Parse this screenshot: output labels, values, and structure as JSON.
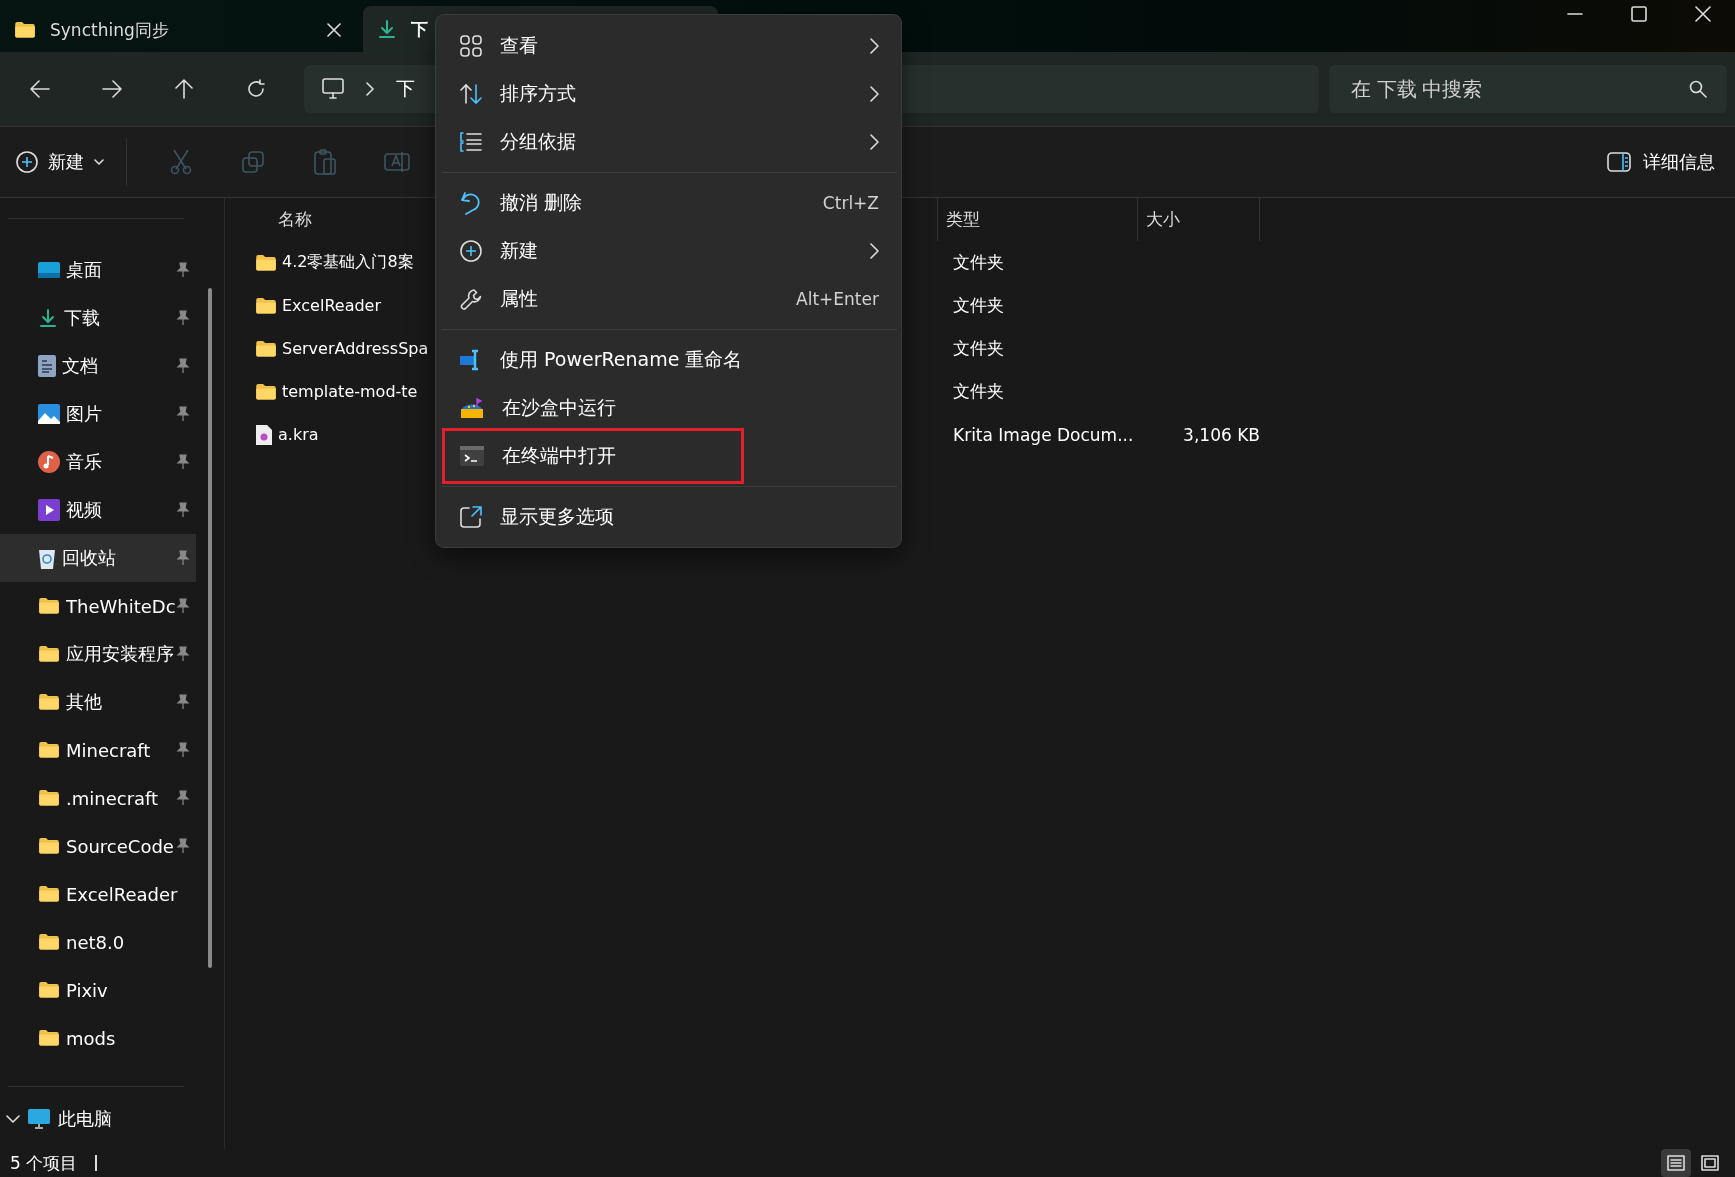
{
  "tabs": [
    {
      "label": "Syncthing同步",
      "kind": "folder",
      "selected": false
    },
    {
      "label": "下",
      "kind": "download",
      "selected": true
    }
  ],
  "address_bar": {
    "crumbs": [
      "下"
    ]
  },
  "search": {
    "placeholder": "在 下载 中搜索"
  },
  "command_bar": {
    "new_label": "新建",
    "details_label": "详细信息"
  },
  "sidebar": {
    "items": [
      {
        "label": "桌面",
        "kind": "desktop",
        "pinned": true,
        "selected": false
      },
      {
        "label": "下载",
        "kind": "download",
        "pinned": true,
        "selected": false
      },
      {
        "label": "文档",
        "kind": "document",
        "pinned": true,
        "selected": false
      },
      {
        "label": "图片",
        "kind": "picture",
        "pinned": true,
        "selected": false
      },
      {
        "label": "音乐",
        "kind": "music",
        "pinned": true,
        "selected": false
      },
      {
        "label": "视频",
        "kind": "video",
        "pinned": true,
        "selected": false
      },
      {
        "label": "回收站",
        "kind": "recycle",
        "pinned": true,
        "selected": true
      },
      {
        "label": "TheWhiteDc",
        "kind": "folder",
        "pinned": true,
        "selected": false
      },
      {
        "label": "应用安装程序",
        "kind": "folder",
        "pinned": true,
        "selected": false
      },
      {
        "label": "其他",
        "kind": "folder",
        "pinned": true,
        "selected": false
      },
      {
        "label": "Minecraft",
        "kind": "folder",
        "pinned": true,
        "selected": false
      },
      {
        "label": ".minecraft",
        "kind": "folder",
        "pinned": true,
        "selected": false
      },
      {
        "label": "SourceCode",
        "kind": "folder",
        "pinned": true,
        "selected": false
      },
      {
        "label": "ExcelReader",
        "kind": "folder",
        "pinned": false,
        "selected": false
      },
      {
        "label": "net8.0",
        "kind": "folder",
        "pinned": false,
        "selected": false
      },
      {
        "label": "Pixiv",
        "kind": "folder",
        "pinned": false,
        "selected": false
      },
      {
        "label": "mods",
        "kind": "folder",
        "pinned": false,
        "selected": false
      }
    ],
    "this_pc": {
      "label": "此电脑",
      "expanded": true
    }
  },
  "table": {
    "columns": [
      "名称",
      "类型",
      "大小"
    ],
    "rows": [
      {
        "name": "4.2零基础入门8案",
        "kind": "folder",
        "type": "文件夹"
      },
      {
        "name": "ExcelReader",
        "kind": "folder",
        "type": "文件夹"
      },
      {
        "name": "ServerAddressSpa",
        "kind": "folder",
        "type": "文件夹"
      },
      {
        "name": "template-mod-te",
        "kind": "folder",
        "type": "文件夹"
      },
      {
        "name": "a.kra",
        "kind": "file",
        "type": "Krita Image Docum...",
        "size": "3,106 KB"
      }
    ]
  },
  "context_menu": {
    "sections": [
      [
        {
          "label": "查看",
          "kind": "grid",
          "submenu": true,
          "highlighted": false
        },
        {
          "label": "排序方式",
          "kind": "sort",
          "submenu": true,
          "highlighted": false
        },
        {
          "label": "分组依据",
          "kind": "group",
          "submenu": true,
          "highlighted": false
        }
      ],
      [
        {
          "label": "撤消 删除",
          "kind": "undo",
          "shortcut": "Ctrl+Z",
          "submenu": false,
          "highlighted": false
        },
        {
          "label": "新建",
          "kind": "plus",
          "submenu": true,
          "highlighted": false
        },
        {
          "label": "属性",
          "kind": "wrench",
          "shortcut": "Alt+Enter",
          "submenu": false,
          "highlighted": false
        }
      ],
      [
        {
          "label": "使用 PowerRename 重命名",
          "kind": "rename",
          "submenu": false,
          "highlighted": false
        },
        {
          "label": "在沙盒中运行",
          "kind": "sandbox",
          "submenu": false,
          "highlighted": false
        },
        {
          "label": "在终端中打开",
          "kind": "terminal",
          "submenu": false,
          "highlighted": true
        }
      ],
      [
        {
          "label": "显示更多选项",
          "kind": "more",
          "submenu": false,
          "highlighted": false
        }
      ]
    ]
  },
  "status_bar": {
    "count": "5 个项目"
  }
}
